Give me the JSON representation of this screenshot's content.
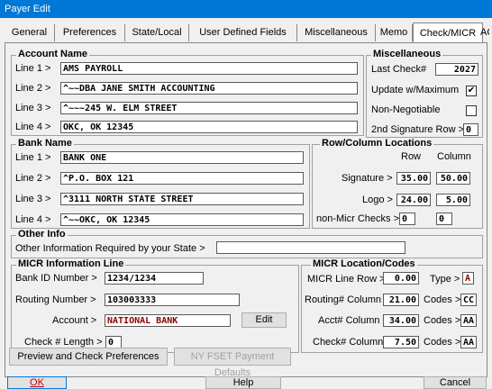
{
  "window": {
    "title": "Payer Edit"
  },
  "tabs": [
    "General",
    "Preferences",
    "State/Local",
    "User Defined Fields",
    "Miscellaneous",
    "Memo",
    "Check/MICR",
    "ACA"
  ],
  "account_name": {
    "title": "Account Name",
    "lines": [
      {
        "label": "Line 1 >",
        "value": "AMS PAYROLL"
      },
      {
        "label": "Line 2 >",
        "value": "^~~DBA JANE SMITH ACCOUNTING"
      },
      {
        "label": "Line 3 >",
        "value": "^~~~245 W. ELM STREET"
      },
      {
        "label": "Line 4 >",
        "value": "OKC, OK 12345"
      }
    ]
  },
  "misc": {
    "title": "Miscellaneous",
    "last_check_label": "Last Check#",
    "last_check_value": "2027",
    "update_label": "Update w/Maximum",
    "update_checked": "✔",
    "non_negotiable_label": "Non-Negotiable",
    "non_negotiable_checked": "",
    "sig_row_label": "2nd Signature Row >",
    "sig_row_value": "0"
  },
  "bank_name": {
    "title": "Bank Name",
    "lines": [
      {
        "label": "Line 1 >",
        "value": "BANK ONE"
      },
      {
        "label": "Line 2 >",
        "value": "^P.O. BOX 121"
      },
      {
        "label": "Line 3 >",
        "value": "^3111 NORTH STATE STREET"
      },
      {
        "label": "Line 4 >",
        "value": "^~~OKC, OK 12345"
      }
    ]
  },
  "rowcol": {
    "title": "Row/Column Locations",
    "row_header": "Row",
    "col_header": "Column",
    "signature_label": "Signature >",
    "signature_row": "35.00",
    "signature_col": "50.00",
    "logo_label": "Logo >",
    "logo_row": "24.00",
    "logo_col": "5.00",
    "nonmicr_label": "non-Micr Checks >",
    "nonmicr_row": "0",
    "nonmicr_col": "0"
  },
  "other_info": {
    "title": "Other Info",
    "label": "Other Information Required by your State >",
    "value": ""
  },
  "micr_info": {
    "title": "MICR Information Line",
    "bank_id_label": "Bank ID Number >",
    "bank_id_value": "1234/1234",
    "routing_label": "Routing Number >",
    "routing_value": "103003333",
    "account_label": "Account >",
    "account_value": "NATIONAL BANK",
    "edit_label": "Edit",
    "check_len_label": "Check # Length >",
    "check_len_value": "0"
  },
  "micr_loc": {
    "title": "MICR Location/Codes",
    "line_row_label": "MICR Line Row >",
    "line_row_value": "0.00",
    "type_label": "Type >",
    "type_value": "A",
    "routing_col_label": "Routing# Column >",
    "routing_col_value": "21.00",
    "routing_codes_label": "Codes >",
    "routing_codes_value": "CC",
    "acct_col_label": "Acct# Column >",
    "acct_col_value": "34.00",
    "acct_codes_label": "Codes >",
    "acct_codes_value": "AA",
    "check_col_label": "Check# Column >",
    "check_col_value": "7.50",
    "check_codes_label": "Codes >",
    "check_codes_value": "AA"
  },
  "buttons": {
    "preview": "Preview and Check Preferences",
    "nyfset": "NY FSET Payment Defaults",
    "ok": "OK",
    "help": "Help",
    "cancel": "Cancel"
  }
}
